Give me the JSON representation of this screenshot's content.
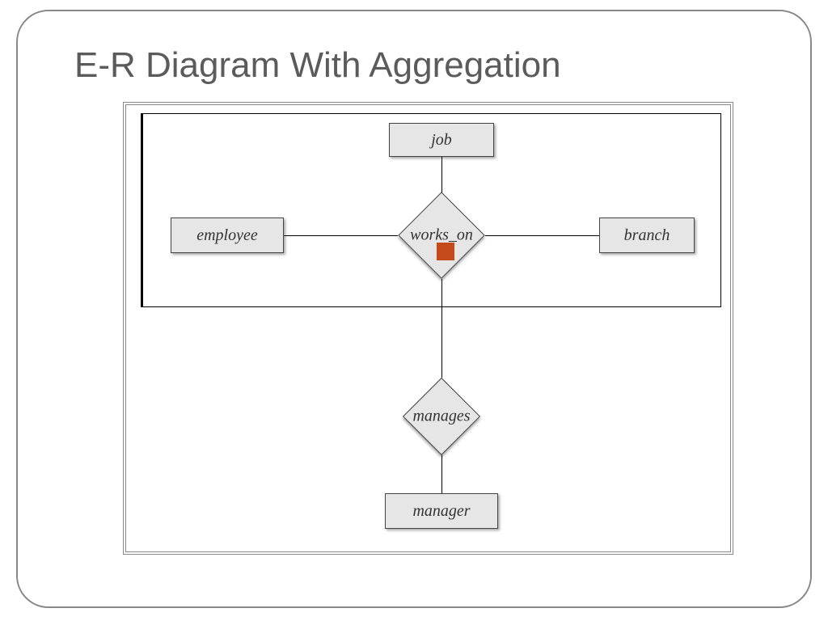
{
  "title": "E-R Diagram With Aggregation",
  "entities": {
    "job": "job",
    "employee": "employee",
    "branch": "branch",
    "manager": "manager"
  },
  "relationships": {
    "works_on": "works_on",
    "manages": "manages"
  },
  "chart_data": {
    "type": "er-diagram",
    "title": "E-R Diagram With Aggregation",
    "entities": [
      "job",
      "employee",
      "branch",
      "manager"
    ],
    "relationships": [
      {
        "name": "works_on",
        "connects": [
          "employee",
          "job",
          "branch"
        ],
        "in_aggregation": true
      },
      {
        "name": "manages",
        "connects": [
          "aggregation(works_on)",
          "manager"
        ],
        "in_aggregation": false
      }
    ],
    "aggregation": {
      "wraps_relationship": "works_on",
      "wraps_entities": [
        "employee",
        "job",
        "branch"
      ]
    }
  }
}
